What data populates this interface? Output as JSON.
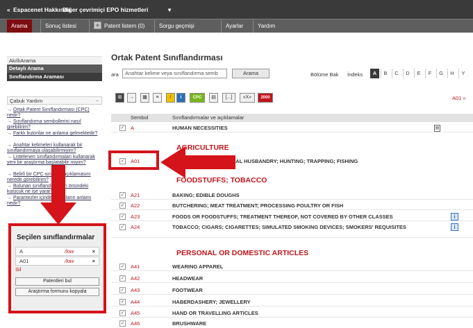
{
  "topbar": {
    "back": "«",
    "about": "Espacenet Hakkında",
    "other": "Diğer çevrimiçi EPO hizmetleri",
    "dropdown": "▾"
  },
  "tabs": [
    "Arama",
    "Sonuç listesi",
    "Patent listem (0)",
    "Sorgu geçmişi",
    "Ayarlar",
    "Yardım"
  ],
  "left": {
    "nav": [
      "AkıllıArama",
      "Detaylı Arama",
      "Sınıflandırma Araması"
    ],
    "quick_help": "Çabuk Yardım",
    "quick_help_toggle": "–",
    "help_links": [
      "Ortak Patent Sınıflandırması (CPC) nedir?",
      "Sınıflandırma sembollerini nasıl girebilirim?",
      "Farklı butonlar ne anlama gelmektedir?",
      "Anahtar kelimeleri kullanarak bir sınıflandırmaya ulaşabilirmiyim?",
      "Listelenen sınıflandırmaları kullanarak yeni bir araştırma başlatabilir miyim?",
      "Belirli bir CPC sınıfının açıklamasını nerede görebilirim?",
      "Bulunan sınıflandırmanın önündeki kutucuk ne işe yarar?",
      "Parantezler içindeki yazıların anlamı nedir?"
    ],
    "help_arrow": "→"
  },
  "selected": {
    "title": "Seçilen sınıflandırmalar",
    "rows": [
      {
        "code": "A",
        "view": "/low",
        "remove": "×"
      },
      {
        "code": "A01",
        "view": "/low",
        "remove": "×"
      }
    ],
    "clear": "Sil",
    "find_button": "Patentleri bul",
    "copy_button": "Araştırma formunu kopyala"
  },
  "main": {
    "title": "Ortak Patent Sınıflandırması",
    "search_label": "ara",
    "search_value": "Anahtar kelime veya sınıflandırma semb",
    "search_button": "Arama",
    "section_label": "Bölüme Bak",
    "index_label": "İndeks",
    "letters": [
      "A",
      "B",
      "C",
      "D",
      "E",
      "F",
      "G",
      "H",
      "Y"
    ],
    "active_letter": "A",
    "next_link": "A01 »"
  },
  "toolbar": {
    "buttons": [
      "⊞",
      "→",
      "▦",
      "≡",
      "!",
      "i",
      "CPC",
      "▤",
      "[...]",
      "»X«",
      "2000"
    ]
  },
  "table": {
    "header_symbol": "Sembol",
    "header_desc": "Sınıflandırmalar ve açıklamalar",
    "check": "✓",
    "info": "i",
    "top_row": {
      "code": "A",
      "desc": "HUMAN NECESSITIES"
    },
    "sections": [
      "AGRICULTURE",
      "FOODSTUFFS; TOBACCO",
      "PERSONAL OR DOMESTIC ARTICLES"
    ],
    "a01": {
      "code": "A01",
      "desc": "AGRICULTURE; FORESTRY; ANIMAL HUSBANDRY; HUNTING; TRAPPING; FISHING",
      "desc_visible": "ANIMAL HUSBANDRY; HUNTING; TRAPPING; FISHING"
    },
    "foodstuffs": [
      {
        "code": "A21",
        "desc": "BAKING; EDIBLE DOUGHS"
      },
      {
        "code": "A22",
        "desc": "BUTCHERING; MEAT TREATMENT; PROCESSING POULTRY OR FISH"
      },
      {
        "code": "A23",
        "desc": "FOODS OR FOODSTUFFS; TREATMENT THEREOF, NOT COVERED BY OTHER CLASSES"
      },
      {
        "code": "A24",
        "desc": "TOBACCO; CIGARS; CIGARETTES; SIMULATED SMOKING DEVICES; SMOKERS' REQUISITES"
      }
    ],
    "personal": [
      {
        "code": "A41",
        "desc": "WEARING APPAREL"
      },
      {
        "code": "A42",
        "desc": "HEADWEAR"
      },
      {
        "code": "A43",
        "desc": "FOOTWEAR"
      },
      {
        "code": "A44",
        "desc": "HABERDASHERY; JEWELLERY"
      },
      {
        "code": "A45",
        "desc": "HAND OR TRAVELLING ARTICLES"
      },
      {
        "code": "A46",
        "desc": "BRUSHWARE"
      }
    ]
  },
  "colors": {
    "accent": "#c0141b",
    "highlight": "#d4131b",
    "topbar": "#3a3a3a",
    "tabbar": "#5e5e5e"
  }
}
